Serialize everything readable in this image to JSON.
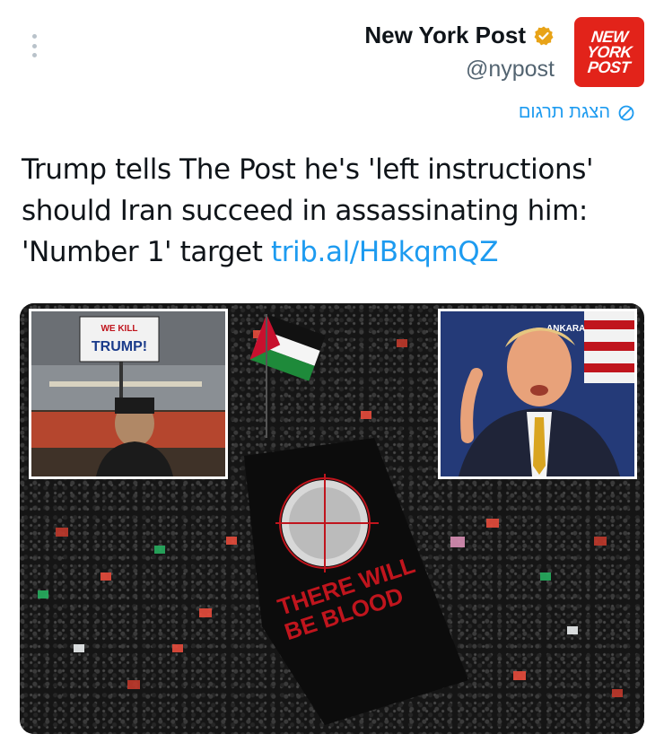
{
  "tweet": {
    "author": {
      "display_name": "New York Post",
      "handle": "@nypost",
      "avatar_text": [
        "NEW",
        "YORK",
        "POST"
      ],
      "verified_icon": "verified-badge-icon"
    },
    "translate_label": "הצגת תרגום",
    "text": "Trump tells The Post he's 'left instructions' should Iran succeed in assassinating him: 'Number 1' target",
    "link": "trib.al/HBkqmQZ",
    "media": {
      "sign_line1": "WE KILL",
      "sign_line2": "TRUMP!",
      "banner_line1": "THERE WILL",
      "banner_line2": "BE BLOOD",
      "backdrop_text": "ANKARA"
    }
  },
  "colors": {
    "link": "#1d9bf0",
    "handle": "#536471",
    "avatar_bg": "#e2231a",
    "verified": "#e8a317"
  }
}
